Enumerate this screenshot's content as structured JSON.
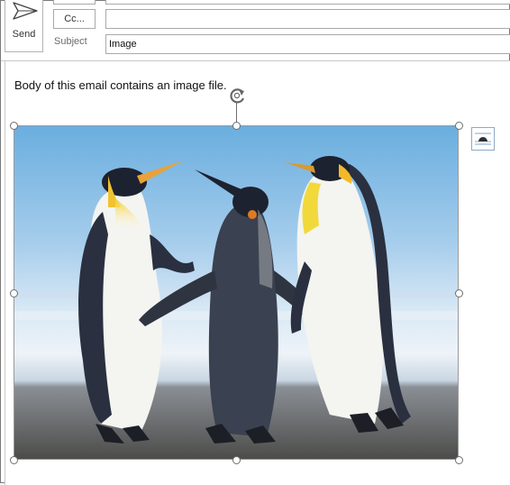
{
  "compose": {
    "send_label": "Send",
    "cc_label": "Cc...",
    "subject_label": "Subject",
    "subject_value": "Image",
    "to_value": "",
    "cc_value": ""
  },
  "message": {
    "body_text": "Body of this email contains an image file."
  },
  "icons": {
    "send": "send-icon",
    "rotate": "rotate-icon",
    "layout_options": "layout-options-icon"
  },
  "colors": {
    "accent_blue": "#2e6db4",
    "border_gray": "#a9a9a9"
  }
}
